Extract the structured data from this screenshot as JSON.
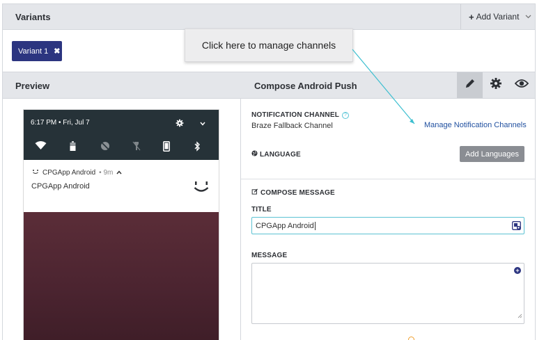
{
  "variants": {
    "title": "Variants",
    "add_variant_label": "Add Variant",
    "chips": [
      {
        "label": "Variant 1"
      }
    ]
  },
  "tooltip": {
    "text": "Click here to manage channels"
  },
  "preview": {
    "title": "Preview",
    "phone": {
      "status_time": "6:17 PM • Fri, Jul 7",
      "notification": {
        "app_name": "CPGApp Android",
        "age": "• 9m",
        "body": "CPGApp Android"
      }
    }
  },
  "compose": {
    "title": "Compose Android Push",
    "notification_channel_label": "NOTIFICATION CHANNEL",
    "notification_channel_value": "Braze Fallback Channel",
    "manage_channels_link": "Manage Notification Channels",
    "language_label": "LANGUAGE",
    "add_languages_label": "Add Languages",
    "compose_message_label": "COMPOSE MESSAGE",
    "title_label": "TITLE",
    "title_value": "CPGApp Android",
    "message_label": "MESSAGE",
    "message_value": ""
  },
  "colors": {
    "accent": "#2c3580",
    "link": "#1f4f9f",
    "focus": "#5cc2d3",
    "phone_status": "#263238"
  }
}
